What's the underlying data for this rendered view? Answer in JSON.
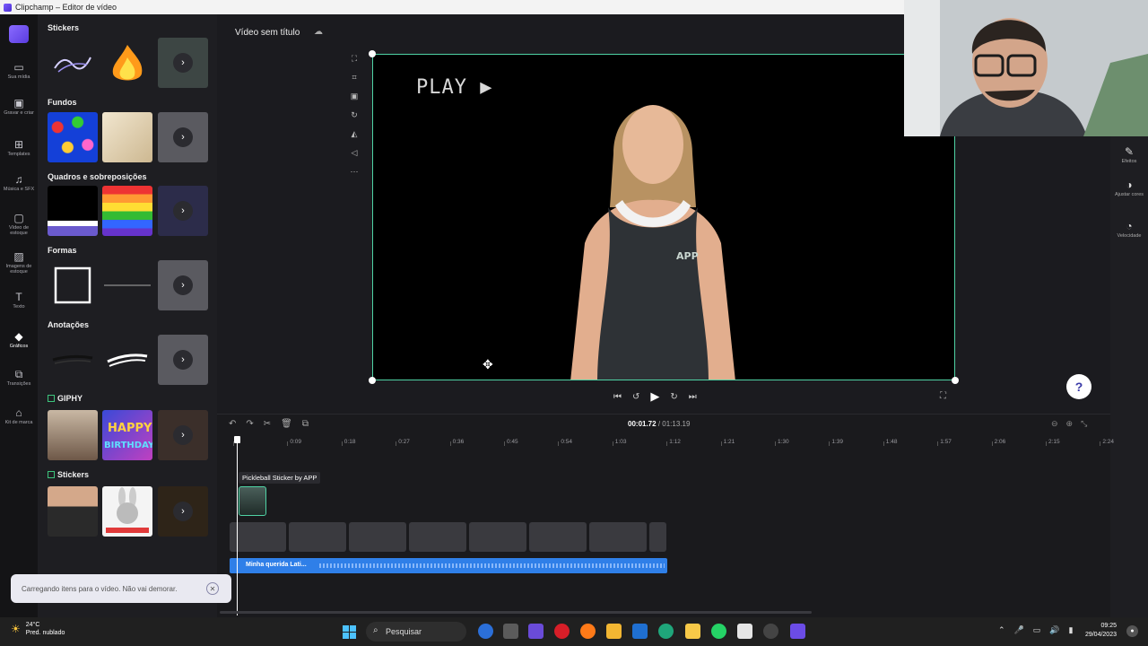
{
  "window": {
    "title": "Clipchamp – Editor de vídeo"
  },
  "rail": {
    "items": [
      {
        "label": "Sua mídia",
        "icon": "folder-icon"
      },
      {
        "label": "Gravar e criar",
        "icon": "camera-icon"
      },
      {
        "label": "Templates",
        "icon": "templates-icon"
      },
      {
        "label": "Música e SFX",
        "icon": "music-icon"
      },
      {
        "label": "Vídeo de estoque",
        "icon": "stock-video-icon"
      },
      {
        "label": "Imagens de estoque",
        "icon": "stock-image-icon"
      },
      {
        "label": "Texto",
        "icon": "text-icon"
      },
      {
        "label": "Gráficos",
        "icon": "graphics-icon",
        "active": true
      },
      {
        "label": "Transições",
        "icon": "transitions-icon"
      },
      {
        "label": "Kit de marca",
        "icon": "brand-kit-icon"
      }
    ]
  },
  "panel": {
    "sections": [
      {
        "title": "Stickers"
      },
      {
        "title": "Fundos"
      },
      {
        "title": "Quadros e sobreposições"
      },
      {
        "title": "Formas"
      },
      {
        "title": "Anotações"
      },
      {
        "title": "GIPHY"
      },
      {
        "title": "Stickers"
      }
    ],
    "more_symbol": "›"
  },
  "project": {
    "title": "Vídeo sem título"
  },
  "preview": {
    "overlay_text": "PLAY ▶",
    "shirt_text": "APP"
  },
  "playback": {
    "skip_back": "⏮",
    "rewind": "↺",
    "play": "▶",
    "forward": "↻",
    "skip_forward": "⏭"
  },
  "right_panel": {
    "items": [
      {
        "label": "Efeitos",
        "icon": "effects-icon"
      },
      {
        "label": "Ajustar cores",
        "icon": "color-adjust-icon"
      },
      {
        "label": "Velocidade",
        "icon": "speed-icon"
      }
    ],
    "help": "?"
  },
  "timeline": {
    "current_time": "00:01.72",
    "total_time": "01:13.19",
    "separator": " / ",
    "ticks": [
      "0",
      "0:09",
      "0:18",
      "0:27",
      "0:36",
      "0:45",
      "0:54",
      "1:03",
      "1:12",
      "1:21",
      "1:30",
      "1:39",
      "1:48",
      "1:57",
      "2:06",
      "2:15",
      "2:24"
    ],
    "sticker_clip_label": "Pickleball Sticker by APP",
    "audio_clip_label": "Minha querida Lati..."
  },
  "toast": {
    "message": "Carregando itens para o vídeo. Não vai demorar.",
    "close": "✕"
  },
  "taskbar": {
    "temperature": "24°C",
    "weather": "Pred. nublado",
    "search_label": "Pesquisar",
    "time": "09:25",
    "date": "29/04/2023"
  }
}
